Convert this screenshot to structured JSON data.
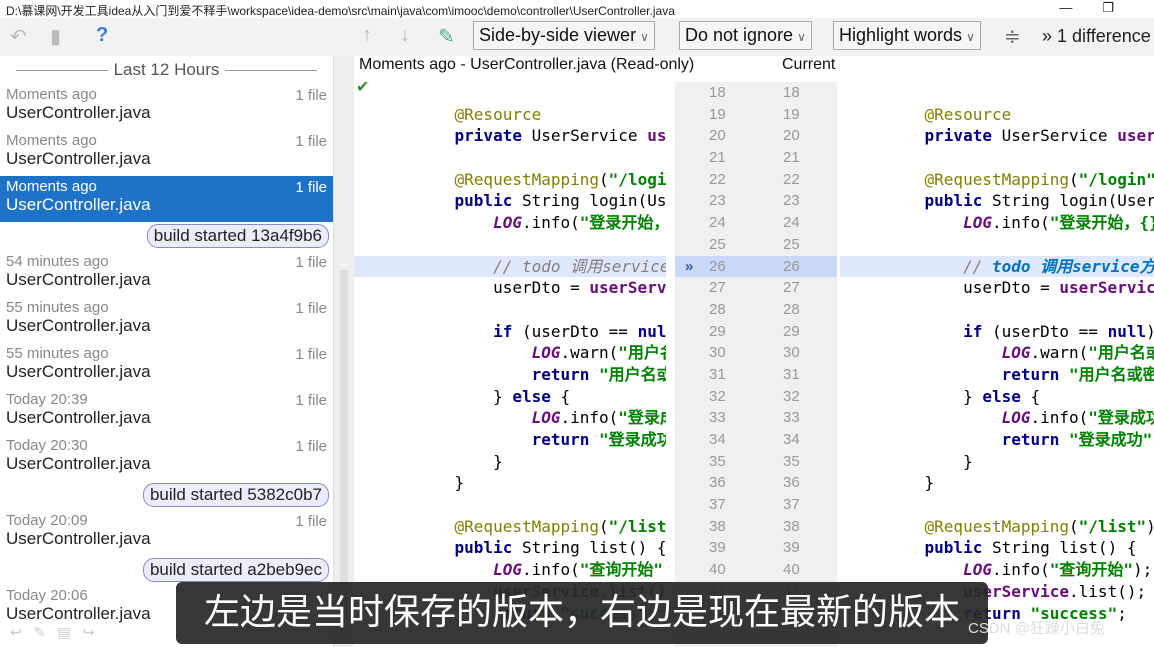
{
  "window": {
    "title": "D:\\慕课网\\开发工具idea从入门到爱不释手\\workspace\\idea-demo\\src\\main\\java\\com\\imooc\\demo\\controller\\UserController.java"
  },
  "toolbar": {
    "viewer": "Side-by-side viewer",
    "ignore": "Do not ignore",
    "highlight": "Highlight words",
    "differences": "» 1 difference",
    "help": "?"
  },
  "history": {
    "header": "Last 12 Hours",
    "entries": [
      {
        "type": "item",
        "time": "Moments ago",
        "count": "1 file",
        "file": "UserController.java"
      },
      {
        "type": "item",
        "time": "Moments ago",
        "count": "1 file",
        "file": "UserController.java"
      },
      {
        "type": "item",
        "time": "Moments ago",
        "count": "1 file",
        "file": "UserController.java",
        "selected": true
      },
      {
        "type": "tag",
        "label": "build started 13a4f9b6"
      },
      {
        "type": "item",
        "time": "54 minutes ago",
        "count": "1 file",
        "file": "UserController.java"
      },
      {
        "type": "item",
        "time": "55 minutes ago",
        "count": "1 file",
        "file": "UserController.java"
      },
      {
        "type": "item",
        "time": "55 minutes ago",
        "count": "1 file",
        "file": "UserController.java"
      },
      {
        "type": "item",
        "time": "Today 20:39",
        "count": "1 file",
        "file": "UserController.java"
      },
      {
        "type": "item",
        "time": "Today 20:30",
        "count": "1 file",
        "file": "UserController.java"
      },
      {
        "type": "tag",
        "label": "build started 5382c0b7"
      },
      {
        "type": "item",
        "time": "Today 20:09",
        "count": "1 file",
        "file": "UserController.java"
      },
      {
        "type": "tag",
        "label": "build started a2beb9ec"
      },
      {
        "type": "item",
        "time": "Today 20:06",
        "count": "",
        "file": "UserController.java"
      }
    ]
  },
  "diff": {
    "left_title": "Moments ago - UserController.java (Read-only)",
    "right_title": "Current",
    "changed_line": 26,
    "lines": [
      {
        "n": 18,
        "t": []
      },
      {
        "n": 19,
        "t": [
          [
            "    ",
            ""
          ],
          [
            "@Resource",
            "ann"
          ]
        ]
      },
      {
        "n": 20,
        "t": [
          [
            "    ",
            ""
          ],
          [
            "private ",
            "kw"
          ],
          [
            "UserService ",
            ""
          ],
          [
            "userService",
            "fld"
          ],
          [
            ";",
            ""
          ]
        ]
      },
      {
        "n": 21,
        "t": []
      },
      {
        "n": 22,
        "t": [
          [
            "    ",
            ""
          ],
          [
            "@RequestMapping",
            "ann"
          ],
          [
            "(",
            ""
          ],
          [
            "\"/login\"",
            "str"
          ],
          [
            ")",
            ""
          ]
        ]
      },
      {
        "n": 23,
        "t": [
          [
            "    ",
            ""
          ],
          [
            "public ",
            "kw"
          ],
          [
            "String login(UserDto userDto) {",
            ""
          ]
        ]
      },
      {
        "n": 24,
        "t": [
          [
            "        ",
            ""
          ],
          [
            "LOG",
            "log"
          ],
          [
            ".info(",
            ""
          ],
          [
            "\"登录开始，{}\"",
            "str"
          ],
          [
            ", userDto);",
            ""
          ]
        ]
      },
      {
        "n": 25,
        "t": []
      },
      {
        "n": 26,
        "t": [
          [
            "        ",
            ""
          ],
          [
            "// todo ",
            "cmt"
          ],
          [
            "调用service方法",
            "cmt"
          ]
        ],
        "r": [
          [
            "        ",
            ""
          ],
          [
            "// ",
            "cmt"
          ],
          [
            "todo 调用service方法",
            "todo"
          ]
        ]
      },
      {
        "n": 27,
        "t": [
          [
            "        userDto = ",
            ""
          ],
          [
            "userService",
            "fld"
          ],
          [
            ".doLogin(userDto);",
            ""
          ]
        ]
      },
      {
        "n": 28,
        "t": []
      },
      {
        "n": 29,
        "t": [
          [
            "        ",
            ""
          ],
          [
            "if ",
            "kw"
          ],
          [
            "(userDto == ",
            ""
          ],
          [
            "null",
            "kw"
          ],
          [
            ") {",
            ""
          ]
        ]
      },
      {
        "n": 30,
        "t": [
          [
            "            ",
            ""
          ],
          [
            "LOG",
            "log"
          ],
          [
            ".warn(",
            ""
          ],
          [
            "\"用户名或密码错误\"",
            "str"
          ],
          [
            ");",
            ""
          ]
        ]
      },
      {
        "n": 31,
        "t": [
          [
            "            ",
            ""
          ],
          [
            "return ",
            "kw"
          ],
          [
            "\"用户名或密码错误\"",
            "str"
          ],
          [
            ";",
            ""
          ]
        ]
      },
      {
        "n": 32,
        "t": [
          [
            "        } ",
            ""
          ],
          [
            "else ",
            "kw"
          ],
          [
            "{",
            ""
          ]
        ]
      },
      {
        "n": 33,
        "t": [
          [
            "            ",
            ""
          ],
          [
            "LOG",
            "log"
          ],
          [
            ".info(",
            ""
          ],
          [
            "\"登录成功\"",
            "str"
          ],
          [
            ");",
            ""
          ]
        ]
      },
      {
        "n": 34,
        "t": [
          [
            "            ",
            ""
          ],
          [
            "return ",
            "kw"
          ],
          [
            "\"登录成功\"",
            "str"
          ],
          [
            ";",
            ""
          ]
        ]
      },
      {
        "n": 35,
        "t": [
          [
            "        }",
            ""
          ]
        ]
      },
      {
        "n": 36,
        "t": [
          [
            "    }",
            ""
          ]
        ]
      },
      {
        "n": 37,
        "t": []
      },
      {
        "n": 38,
        "t": [
          [
            "    ",
            ""
          ],
          [
            "@RequestMapping",
            "ann"
          ],
          [
            "(",
            ""
          ],
          [
            "\"/list\"",
            "str"
          ],
          [
            ")",
            ""
          ]
        ]
      },
      {
        "n": 39,
        "t": [
          [
            "    ",
            ""
          ],
          [
            "public ",
            "kw"
          ],
          [
            "String list() {",
            ""
          ]
        ]
      },
      {
        "n": 40,
        "t": [
          [
            "        ",
            ""
          ],
          [
            "LOG",
            "log"
          ],
          [
            ".info(",
            ""
          ],
          [
            "\"查询开始\"",
            "str"
          ],
          [
            ");",
            ""
          ]
        ]
      },
      {
        "n": 41,
        "t": [
          [
            "        ",
            ""
          ],
          [
            "userService",
            "fld"
          ],
          [
            ".list();",
            ""
          ]
        ]
      },
      {
        "n": 42,
        "t": [
          [
            "        ",
            ""
          ],
          [
            "return ",
            "kw"
          ],
          [
            "\"success\"",
            "str"
          ],
          [
            ";",
            ""
          ]
        ]
      }
    ]
  },
  "subtitle": "左边是当时保存的版本，右边是现在最新的版本",
  "watermark": "CSDN @狂躁小白兔"
}
